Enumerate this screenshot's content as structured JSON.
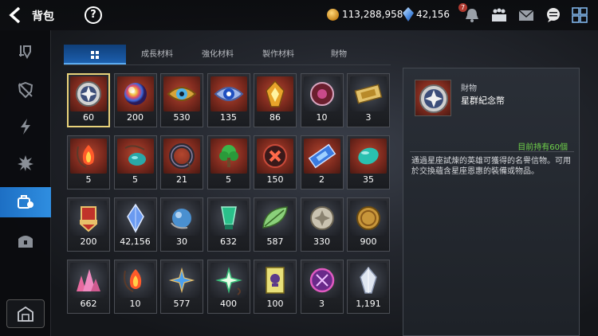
{
  "header": {
    "title": "背包",
    "help_label": "?",
    "gold": "113,288,958",
    "gems": "42,156",
    "notification_count": "7"
  },
  "tabs": [
    "成長材料",
    "強化材料",
    "製作材料",
    "財物"
  ],
  "items": [
    {
      "count": "60",
      "icon": "star-emblem-coin",
      "selected": true
    },
    {
      "count": "200",
      "icon": "rainbow-orb"
    },
    {
      "count": "530",
      "icon": "gold-eye-emblem"
    },
    {
      "count": "135",
      "icon": "blue-eye-emblem"
    },
    {
      "count": "86",
      "icon": "flame-crystal"
    },
    {
      "count": "10",
      "icon": "rune-disc"
    },
    {
      "count": "3",
      "icon": "golden-ticket"
    },
    {
      "count": "5",
      "icon": "red-flame-pendant"
    },
    {
      "count": "5",
      "icon": "teal-pendant"
    },
    {
      "count": "21",
      "icon": "dark-ring"
    },
    {
      "count": "5",
      "icon": "green-tree-pendant"
    },
    {
      "count": "150",
      "icon": "red-cross-seal"
    },
    {
      "count": "2",
      "icon": "blue-ticket"
    },
    {
      "count": "35",
      "icon": "teal-gem"
    },
    {
      "count": "200",
      "icon": "red-banner-crest"
    },
    {
      "count": "42,156",
      "icon": "blue-crystal"
    },
    {
      "count": "30",
      "icon": "blue-pearl"
    },
    {
      "count": "632",
      "icon": "green-crystal-cup"
    },
    {
      "count": "587",
      "icon": "green-leaf"
    },
    {
      "count": "330",
      "icon": "silver-star-coin"
    },
    {
      "count": "900",
      "icon": "gold-coin"
    },
    {
      "count": "662",
      "icon": "pink-crystal-cluster"
    },
    {
      "count": "10",
      "icon": "red-flame-pendant"
    },
    {
      "count": "577",
      "icon": "blue-star-pendant"
    },
    {
      "count": "400",
      "icon": "green-star-pendant"
    },
    {
      "count": "100",
      "icon": "skull-card"
    },
    {
      "count": "3",
      "icon": "purple-rune-coin"
    },
    {
      "count": "1,191",
      "icon": "white-crystal"
    }
  ],
  "detail": {
    "category": "財物",
    "name": "星群紀念幣",
    "held": "目前持有60個",
    "description": "通過星座試煉的英雄可獲得的名譽信物。可用於交換蘊含星座恩惠的裝備或物品。"
  },
  "colors": {
    "accent": "#2f8ee0",
    "selected": "#e8d27a",
    "held_text": "#6fd24a"
  }
}
